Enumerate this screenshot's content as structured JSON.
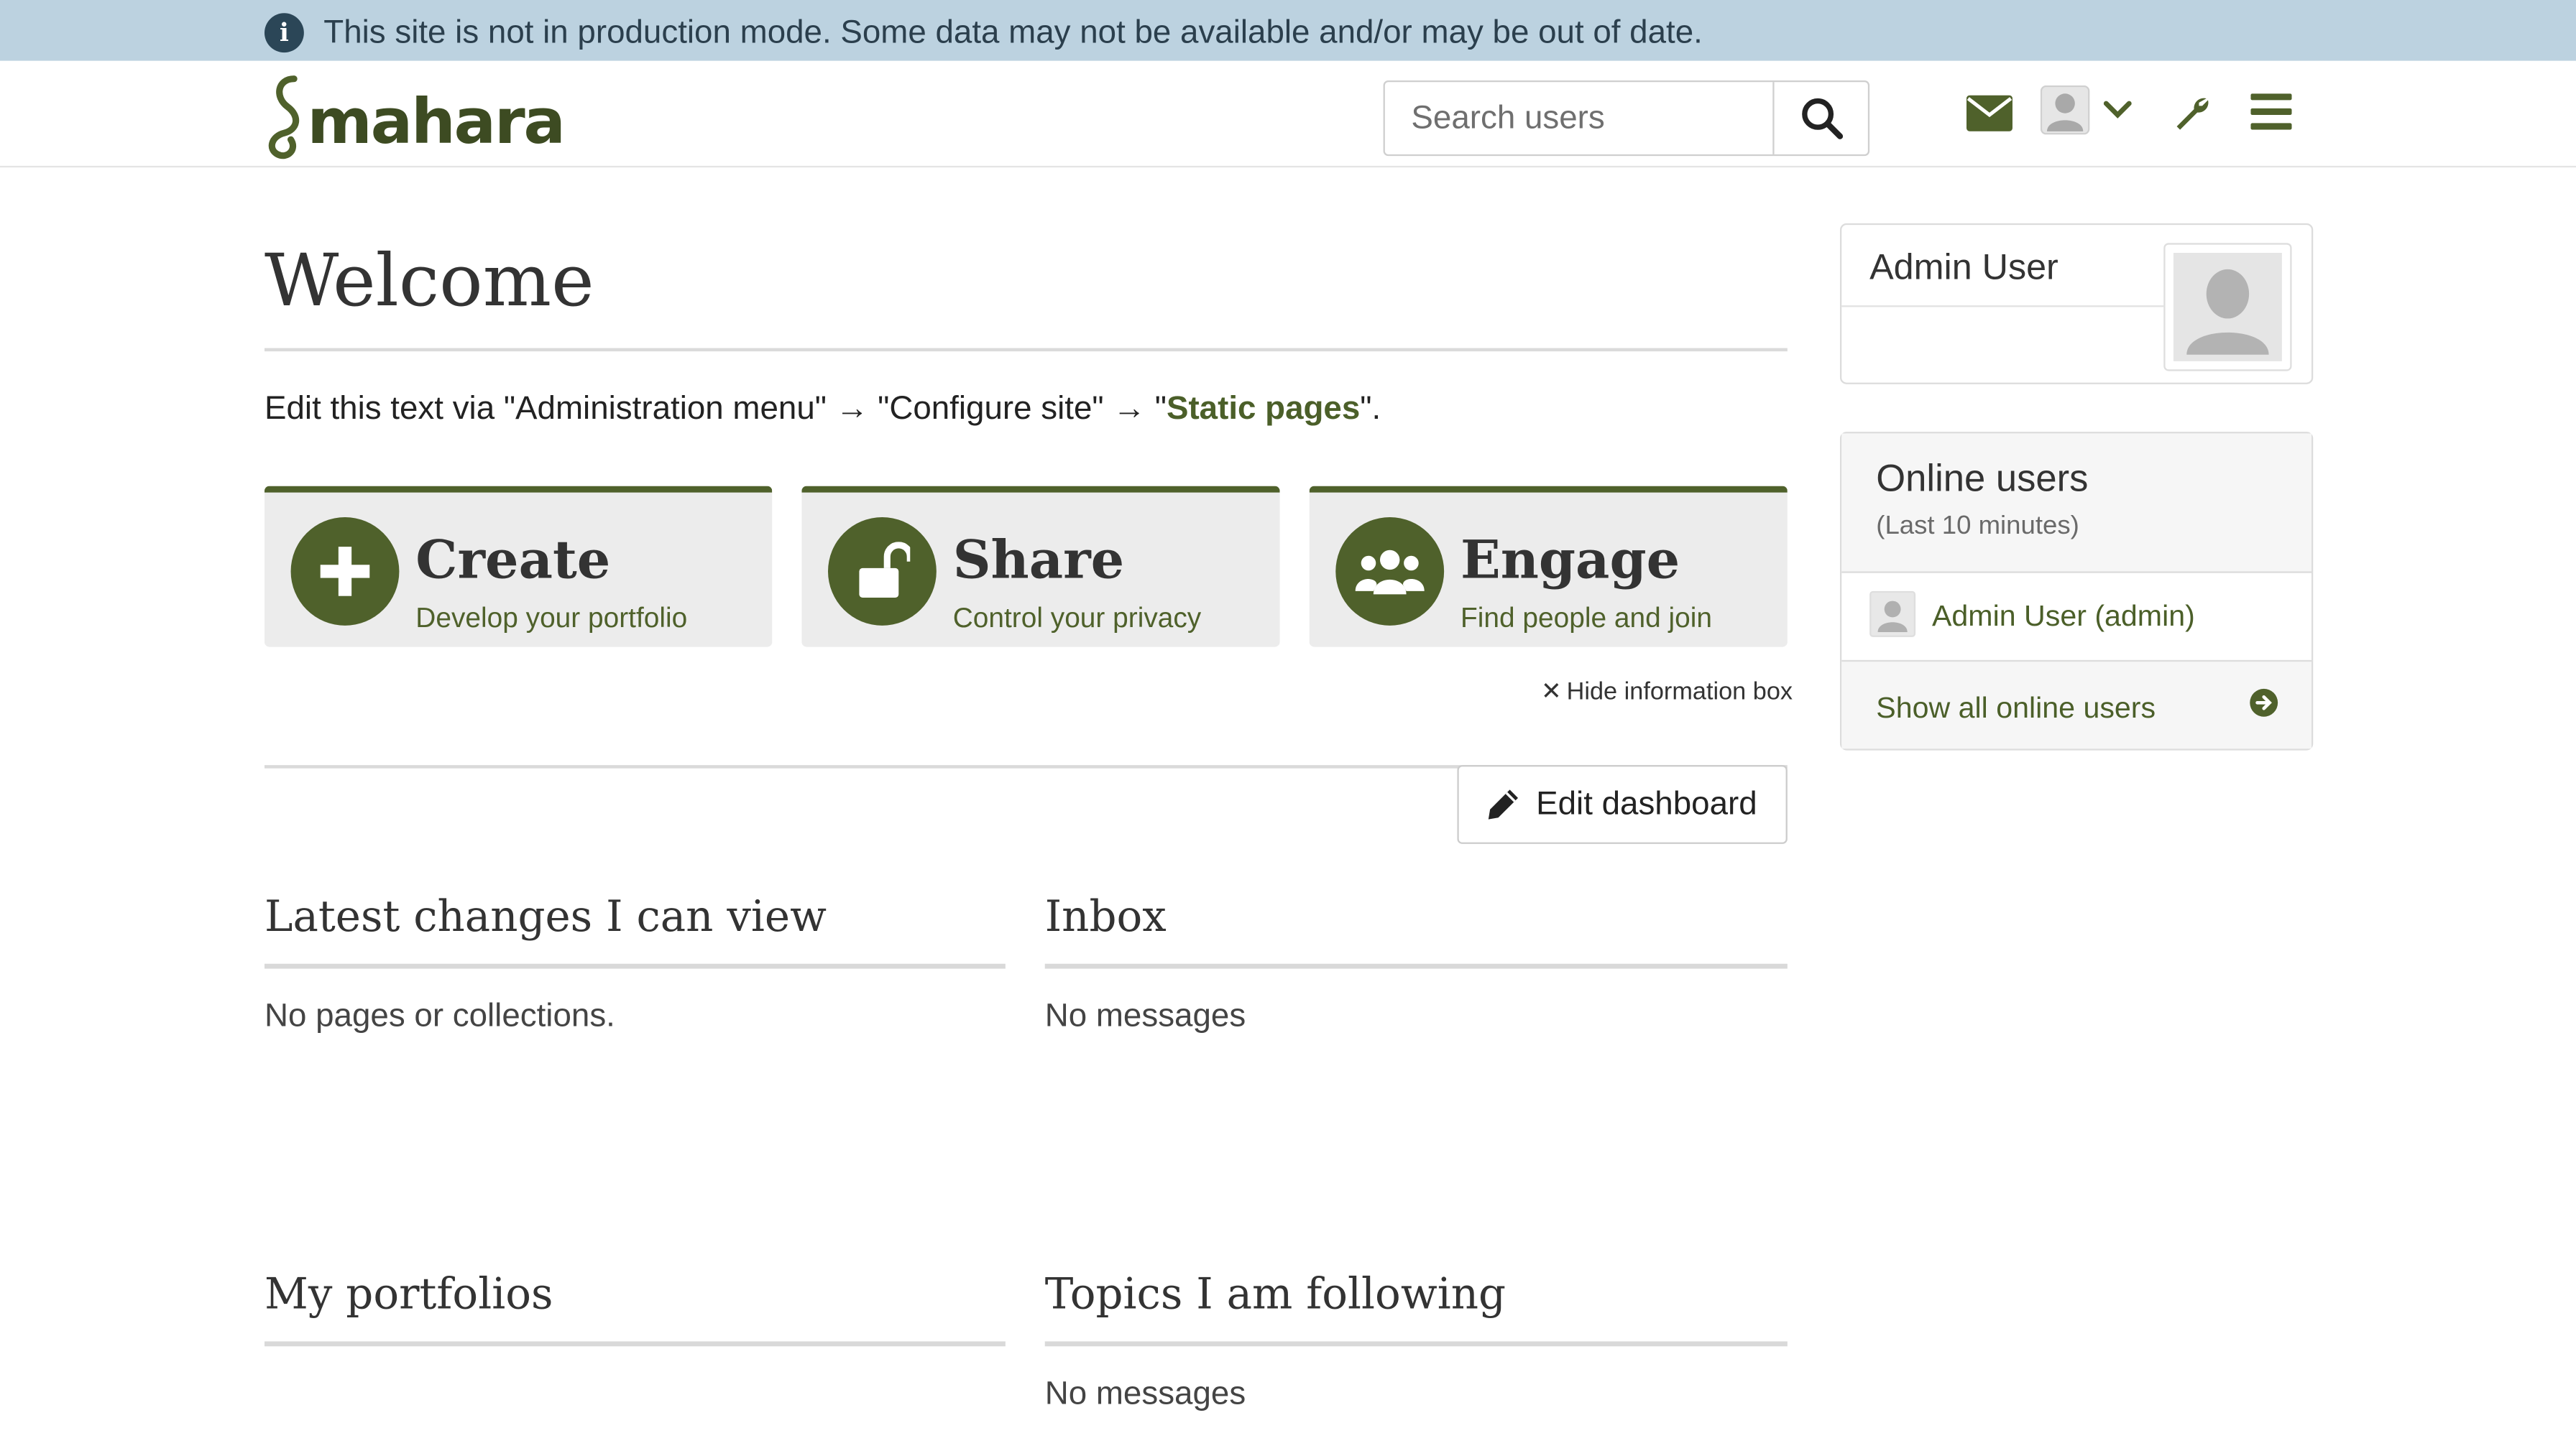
{
  "notice": {
    "text": "This site is not in production mode. Some data may not be available and/or may be out of date."
  },
  "header": {
    "logo_text": "mahara",
    "search": {
      "placeholder": "Search users"
    }
  },
  "main": {
    "title": "Welcome",
    "edit_text_prefix": "Edit this text via \"Administration menu\" → \"Configure site\" → \"",
    "edit_text_link": "Static pages",
    "edit_text_suffix": "\".",
    "cards": [
      {
        "title": "Create",
        "subtitle": "Develop your portfolio",
        "icon": "plus-icon"
      },
      {
        "title": "Share",
        "subtitle": "Control your privacy",
        "icon": "unlock-icon"
      },
      {
        "title": "Engage",
        "subtitle": "Find people and join",
        "icon": "group-icon"
      }
    ],
    "hide_info": "Hide information box",
    "edit_dashboard": "Edit dashboard",
    "sections": [
      {
        "title": "Latest changes I can view",
        "body": "No pages or collections."
      },
      {
        "title": "Inbox",
        "body": "No messages"
      },
      {
        "title": "My portfolios",
        "body": ""
      },
      {
        "title": "Topics I am following",
        "body": "No messages"
      }
    ]
  },
  "sidebar": {
    "profile": {
      "name": "Admin User"
    },
    "online": {
      "title": "Online users",
      "subtitle": "(Last 10 minutes)",
      "users": [
        {
          "name": "Admin User (admin)"
        }
      ],
      "show_all": "Show all online users"
    }
  },
  "colors": {
    "brand": "#4f612b",
    "notice_bg": "#bcd2e0",
    "card_bg": "#ececec"
  }
}
